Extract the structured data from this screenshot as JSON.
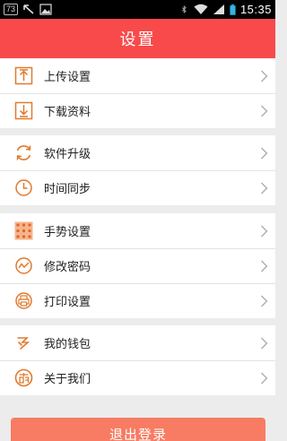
{
  "status_bar": {
    "badge": "73",
    "time": "15:35"
  },
  "header": {
    "title": "设置"
  },
  "colors": {
    "accent": "#f84a4a",
    "icon_orange": "#e07a2e",
    "logout_bg": "#f87c63"
  },
  "groups": [
    {
      "items": [
        {
          "label": "上传设置",
          "icon": "upload-icon"
        },
        {
          "label": "下载资料",
          "icon": "download-icon"
        }
      ]
    },
    {
      "items": [
        {
          "label": "软件升级",
          "icon": "refresh-icon"
        },
        {
          "label": "时间同步",
          "icon": "clock-icon"
        }
      ]
    },
    {
      "items": [
        {
          "label": "手势设置",
          "icon": "gesture-grid-icon"
        },
        {
          "label": "修改密码",
          "icon": "password-wave-icon"
        },
        {
          "label": "打印设置",
          "icon": "printer-icon"
        }
      ]
    },
    {
      "items": [
        {
          "label": "我的钱包",
          "icon": "wallet-icon"
        },
        {
          "label": "关于我们",
          "icon": "about-icon"
        }
      ]
    }
  ],
  "logout": {
    "label": "退出登录"
  }
}
